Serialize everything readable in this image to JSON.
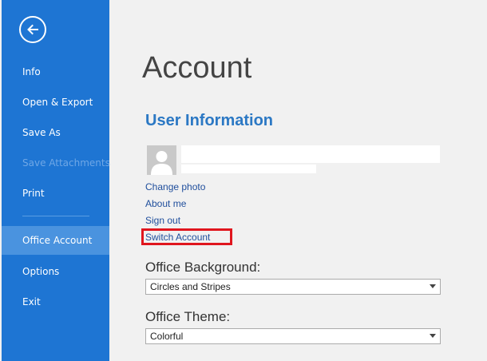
{
  "sidebar": {
    "back_label": "Back",
    "items": [
      {
        "label": "Info",
        "state": "normal"
      },
      {
        "label": "Open & Export",
        "state": "normal"
      },
      {
        "label": "Save As",
        "state": "normal"
      },
      {
        "label": "Save Attachments",
        "state": "disabled"
      },
      {
        "label": "Print",
        "state": "normal"
      },
      {
        "label": "Office Account",
        "state": "selected"
      },
      {
        "label": "Options",
        "state": "normal"
      },
      {
        "label": "Exit",
        "state": "normal"
      }
    ]
  },
  "main": {
    "title": "Account",
    "user_information": {
      "heading": "User Information",
      "links": {
        "change_photo": "Change photo",
        "about_me": "About me",
        "sign_out": "Sign out",
        "switch_account": "Switch Account"
      }
    },
    "office_background": {
      "label": "Office Background:",
      "value": "Circles and Stripes"
    },
    "office_theme": {
      "label": "Office Theme:",
      "value": "Colorful"
    }
  },
  "colors": {
    "sidebar_bg": "#1e75d3",
    "sidebar_selected": "#4a93df",
    "accent_heading": "#2b78c4",
    "link": "#1f4e9c",
    "highlight_border": "#e0161e",
    "page_bg": "#f1f1f1"
  },
  "icons": {
    "back": "back-arrow-circle-icon",
    "avatar": "person-silhouette-icon",
    "dropdown": "chevron-down-icon"
  }
}
